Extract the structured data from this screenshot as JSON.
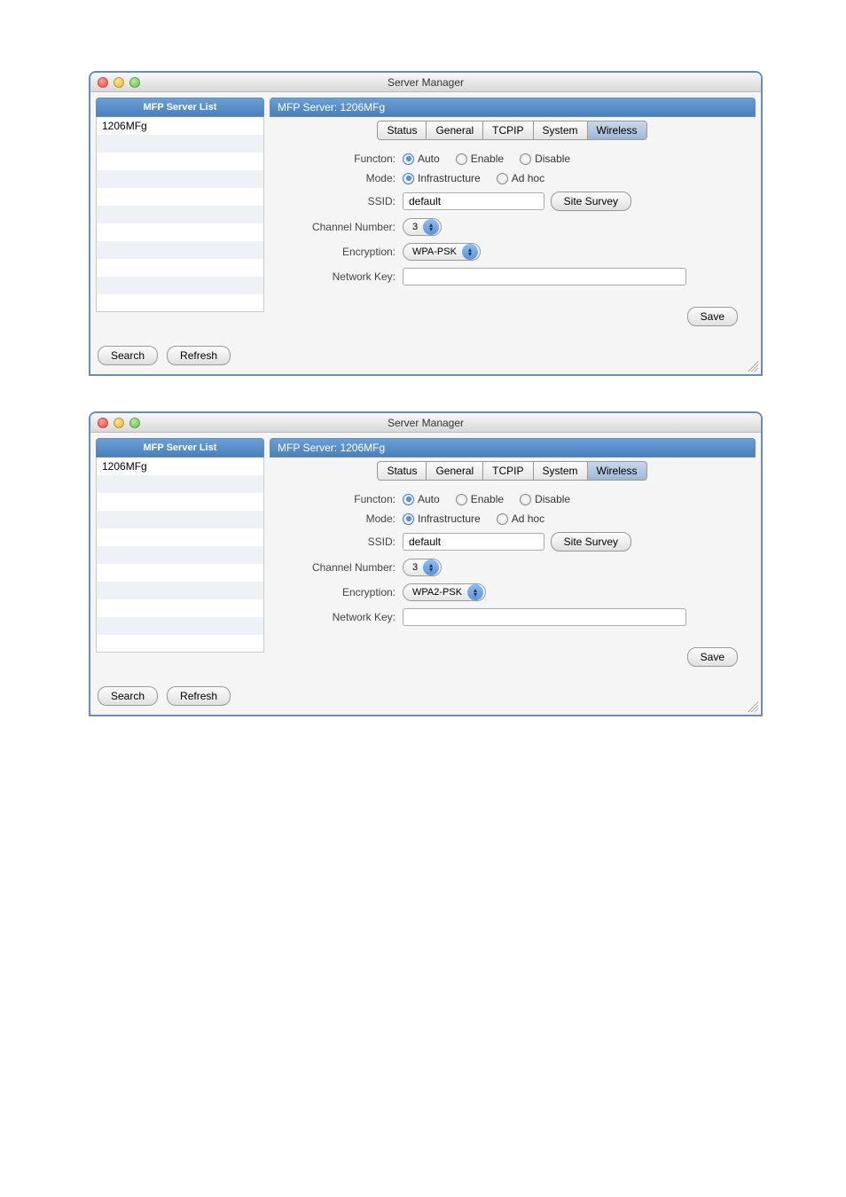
{
  "windows": [
    {
      "title": "Server Manager",
      "sidebar_header": "MFP Server List",
      "sidebar_item": "1206MFg",
      "panel_title": "MFP Server: 1206MFg",
      "tabs": [
        "Status",
        "General",
        "TCPIP",
        "System",
        "Wireless"
      ],
      "active_tab": "Wireless",
      "labels": {
        "function": "Functon:",
        "mode": "Mode:",
        "ssid": "SSID:",
        "channel": "Channel Number:",
        "encryption": "Encryption:",
        "netkey": "Network Key:"
      },
      "function_opts": {
        "auto": "Auto",
        "enable": "Enable",
        "disable": "Disable"
      },
      "mode_opts": {
        "infra": "Infrastructure",
        "adhoc": "Ad hoc"
      },
      "ssid_value": "default",
      "site_survey": "Site Survey",
      "channel_value": "3",
      "encryption_value": "WPA-PSK",
      "netkey_value": "",
      "save": "Save",
      "search": "Search",
      "refresh": "Refresh"
    },
    {
      "title": "Server Manager",
      "sidebar_header": "MFP Server List",
      "sidebar_item": "1206MFg",
      "panel_title": "MFP Server: 1206MFg",
      "tabs": [
        "Status",
        "General",
        "TCPIP",
        "System",
        "Wireless"
      ],
      "active_tab": "Wireless",
      "labels": {
        "function": "Functon:",
        "mode": "Mode:",
        "ssid": "SSID:",
        "channel": "Channel Number:",
        "encryption": "Encryption:",
        "netkey": "Network Key:"
      },
      "function_opts": {
        "auto": "Auto",
        "enable": "Enable",
        "disable": "Disable"
      },
      "mode_opts": {
        "infra": "Infrastructure",
        "adhoc": "Ad hoc"
      },
      "ssid_value": "default",
      "site_survey": "Site Survey",
      "channel_value": "3",
      "encryption_value": "WPA2-PSK",
      "netkey_value": "",
      "save": "Save",
      "search": "Search",
      "refresh": "Refresh"
    }
  ]
}
